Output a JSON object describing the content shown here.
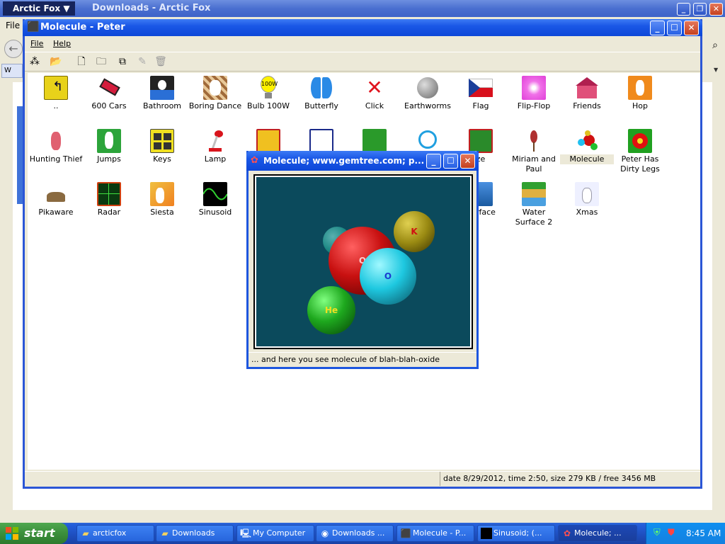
{
  "background_window": {
    "app_menu": "Arctic Fox",
    "title": "Downloads - Arctic Fox",
    "menu_file": "File",
    "tab_label": "W"
  },
  "explorer": {
    "title": "Molecule - Peter",
    "menu": {
      "file": "File",
      "help": "Help"
    },
    "status_text": "date 8/29/2012, time 2:50, size 279 KB / free 3456 MB",
    "icons": [
      {
        "label": "..",
        "icon": "up-folder-icon"
      },
      {
        "label": "600 Cars",
        "icon": "car-icon"
      },
      {
        "label": "Bathroom",
        "icon": "bathroom-icon"
      },
      {
        "label": "Boring Dance",
        "icon": "dance-icon"
      },
      {
        "label": "Bulb 100W",
        "icon": "bulb-icon"
      },
      {
        "label": "Butterfly",
        "icon": "butterfly-icon"
      },
      {
        "label": "Click",
        "icon": "click-icon"
      },
      {
        "label": "Earthworms",
        "icon": "earthworm-icon"
      },
      {
        "label": "Flag",
        "icon": "flag-icon"
      },
      {
        "label": "Flip-Flop",
        "icon": "flipflop-icon"
      },
      {
        "label": "Friends",
        "icon": "house-icon"
      },
      {
        "label": "Hop",
        "icon": "bunny-icon"
      },
      {
        "label": "Hunting Thief",
        "icon": "thief-icon"
      },
      {
        "label": "Jumps",
        "icon": "bunny-icon"
      },
      {
        "label": "Keys",
        "icon": "keys-icon"
      },
      {
        "label": "Lamp",
        "icon": "lamp-icon"
      },
      {
        "label": "ze",
        "icon": "maze-icon"
      },
      {
        "label": "Miriam and Paul",
        "icon": "flowers-icon"
      },
      {
        "label": "Molecule",
        "icon": "molecule-icon"
      },
      {
        "label": "Peter Has Dirty Legs",
        "icon": "flower-icon"
      },
      {
        "label": "Pikaware",
        "icon": "pikaware-icon"
      },
      {
        "label": "Radar",
        "icon": "radar-icon"
      },
      {
        "label": "Siesta",
        "icon": "siesta-icon"
      },
      {
        "label": "Sinusoid",
        "icon": "sine-icon"
      },
      {
        "label": "Surface",
        "icon": "surface-icon"
      },
      {
        "label": "Water Surface 2",
        "icon": "water-icon"
      },
      {
        "label": "Xmas",
        "icon": "xmas-icon"
      }
    ]
  },
  "molecule_window": {
    "title": "Molecule;   www.gemtree.com;   p...",
    "status": "... and here you see molecule of blah-blah-oxide",
    "atoms": [
      {
        "label": "",
        "color": "#1f8a86"
      },
      {
        "label": "O",
        "color": "#c81010"
      },
      {
        "label": "K",
        "color": "#9a8a12"
      },
      {
        "label": "O",
        "color": "#1ec8e0"
      },
      {
        "label": "He",
        "color": "#1ea81e"
      }
    ]
  },
  "taskbar": {
    "start_label": "start",
    "tasks": [
      {
        "label": "arcticfox",
        "icon": "folder-icon"
      },
      {
        "label": "Downloads",
        "icon": "folder-icon"
      },
      {
        "label": "My Computer",
        "icon": "computer-icon"
      },
      {
        "label": "Downloads ...",
        "icon": "browser-icon"
      },
      {
        "label": "Molecule - P...",
        "icon": "app-icon"
      },
      {
        "label": "Sinusoid;  (...",
        "icon": "console-icon"
      },
      {
        "label": "Molecule;  ...",
        "icon": "molecule-icon"
      }
    ],
    "clock": "8:45 AM"
  }
}
